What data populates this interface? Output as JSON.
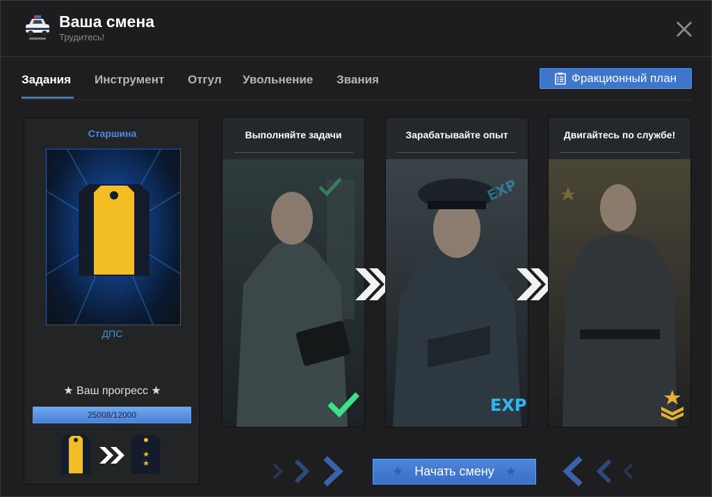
{
  "header": {
    "title": "Ваша смена",
    "subtitle": "Трудитесь!"
  },
  "tabs": [
    {
      "label": "Задания",
      "active": true
    },
    {
      "label": "Инструмент",
      "active": false
    },
    {
      "label": "Отгул",
      "active": false
    },
    {
      "label": "Увольнение",
      "active": false
    },
    {
      "label": "Звания",
      "active": false
    }
  ],
  "plan_button": {
    "label": "Фракционный план",
    "icon": "clipboard-list-icon"
  },
  "rank": {
    "name": "Старшина",
    "unit": "ДПС",
    "progress_label": "★ Ваш прогресс ★",
    "progress_text": "25008/12000",
    "progress_fraction": 1.0
  },
  "cards": [
    {
      "title": "Выполняйте задачи",
      "corner_icon": "checkmark-icon"
    },
    {
      "title": "Зарабатывайте опыт",
      "corner_icon": "exp-icon",
      "corner_text": "EXP"
    },
    {
      "title": "Двигайтесь по службе!",
      "corner_icon": "rank-chevron-icon"
    }
  ],
  "start_button": {
    "label": "Начать смену"
  },
  "colors": {
    "accent": "#3e76cc",
    "rank_yellow": "#f3bd24",
    "check_green": "#3ee08a",
    "exp_blue": "#2fb8f0"
  }
}
